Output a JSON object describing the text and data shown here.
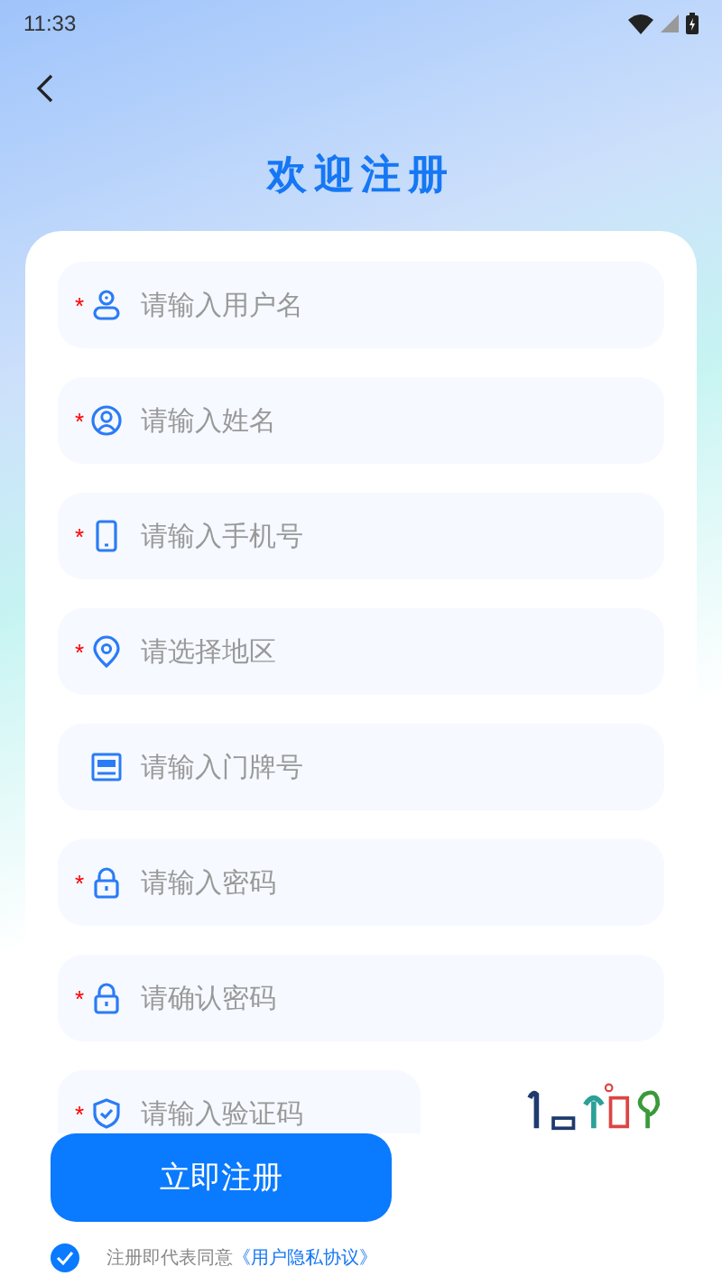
{
  "status_bar": {
    "time": "11:33"
  },
  "header": {
    "title": "欢迎注册"
  },
  "fields": [
    {
      "kind": "user",
      "required_mark": "*",
      "placeholder": "请输入用户名"
    },
    {
      "kind": "name",
      "required_mark": "*",
      "placeholder": "请输入姓名"
    },
    {
      "kind": "phone",
      "required_mark": "*",
      "placeholder": "请输入手机号"
    },
    {
      "kind": "region",
      "required_mark": "*",
      "placeholder": "请选择地区"
    },
    {
      "kind": "doorplate",
      "placeholder": "请输入门牌号"
    },
    {
      "kind": "password",
      "required_mark": "*",
      "placeholder": "请输入密码"
    },
    {
      "kind": "password",
      "required_mark": "*",
      "placeholder": "请确认密码"
    },
    {
      "kind": "captcha",
      "required_mark": "*",
      "placeholder": "请输入验证码"
    }
  ],
  "submit_button": {
    "label": "立即注册"
  },
  "agreement": {
    "checked": true,
    "text": "注册即代表同意",
    "link": "《用户隐私协议》"
  }
}
